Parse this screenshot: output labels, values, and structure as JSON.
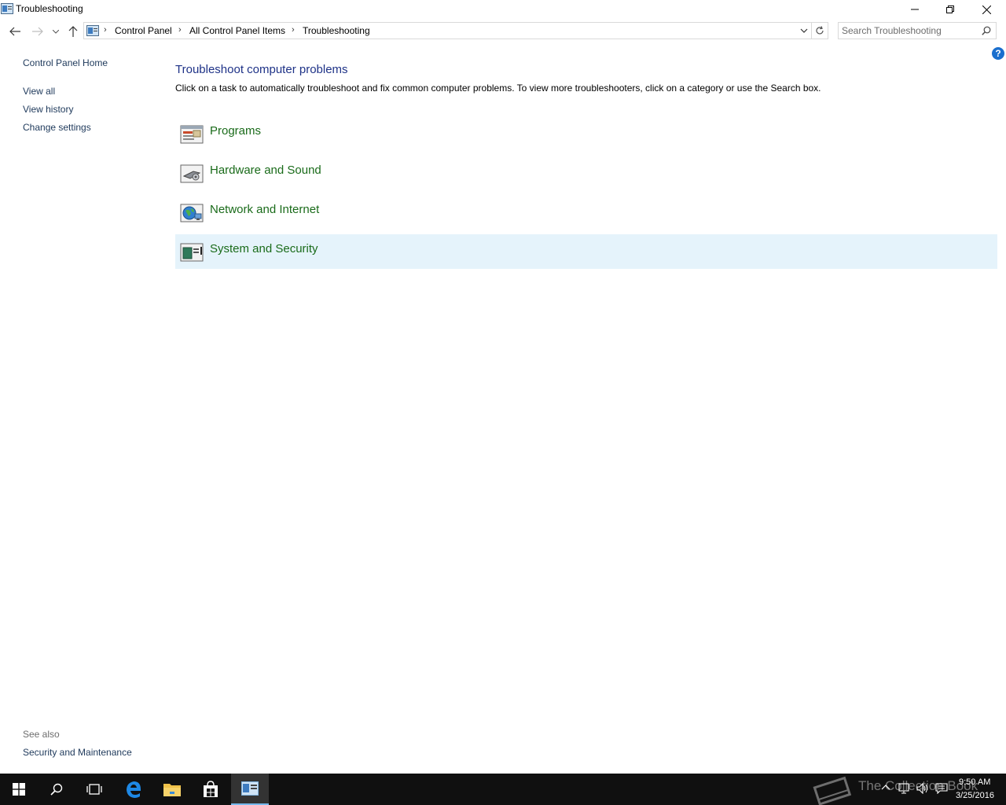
{
  "window": {
    "title": "Troubleshooting"
  },
  "address": {
    "crumbs": [
      "Control Panel",
      "All Control Panel Items",
      "Troubleshooting"
    ]
  },
  "search": {
    "placeholder": "Search Troubleshooting"
  },
  "sidebar": {
    "home": "Control Panel Home",
    "items": [
      {
        "label": "View all"
      },
      {
        "label": "View history"
      },
      {
        "label": "Change settings"
      }
    ],
    "see_also_label": "See also",
    "see_also_items": [
      {
        "label": "Security and Maintenance"
      }
    ]
  },
  "main": {
    "help": "?",
    "title": "Troubleshoot computer problems",
    "description": "Click on a task to automatically troubleshoot and fix common computer problems. To view more troubleshooters, click on a category or use the Search box.",
    "categories": [
      {
        "label": "Programs",
        "icon": "programs-icon"
      },
      {
        "label": "Hardware and Sound",
        "icon": "hardware-sound-icon"
      },
      {
        "label": "Network and Internet",
        "icon": "network-internet-icon"
      },
      {
        "label": "System and Security",
        "icon": "system-security-icon",
        "selected": true
      }
    ]
  },
  "taskbar": {
    "watermark": "The Collection Book",
    "time": "9:50 AM",
    "date": "3/25/2016"
  },
  "colors": {
    "link": "#1e395b",
    "title": "#1e3287",
    "category": "#1a6b1a",
    "selected_bg": "#e5f3fb",
    "taskbar": "#101010"
  }
}
